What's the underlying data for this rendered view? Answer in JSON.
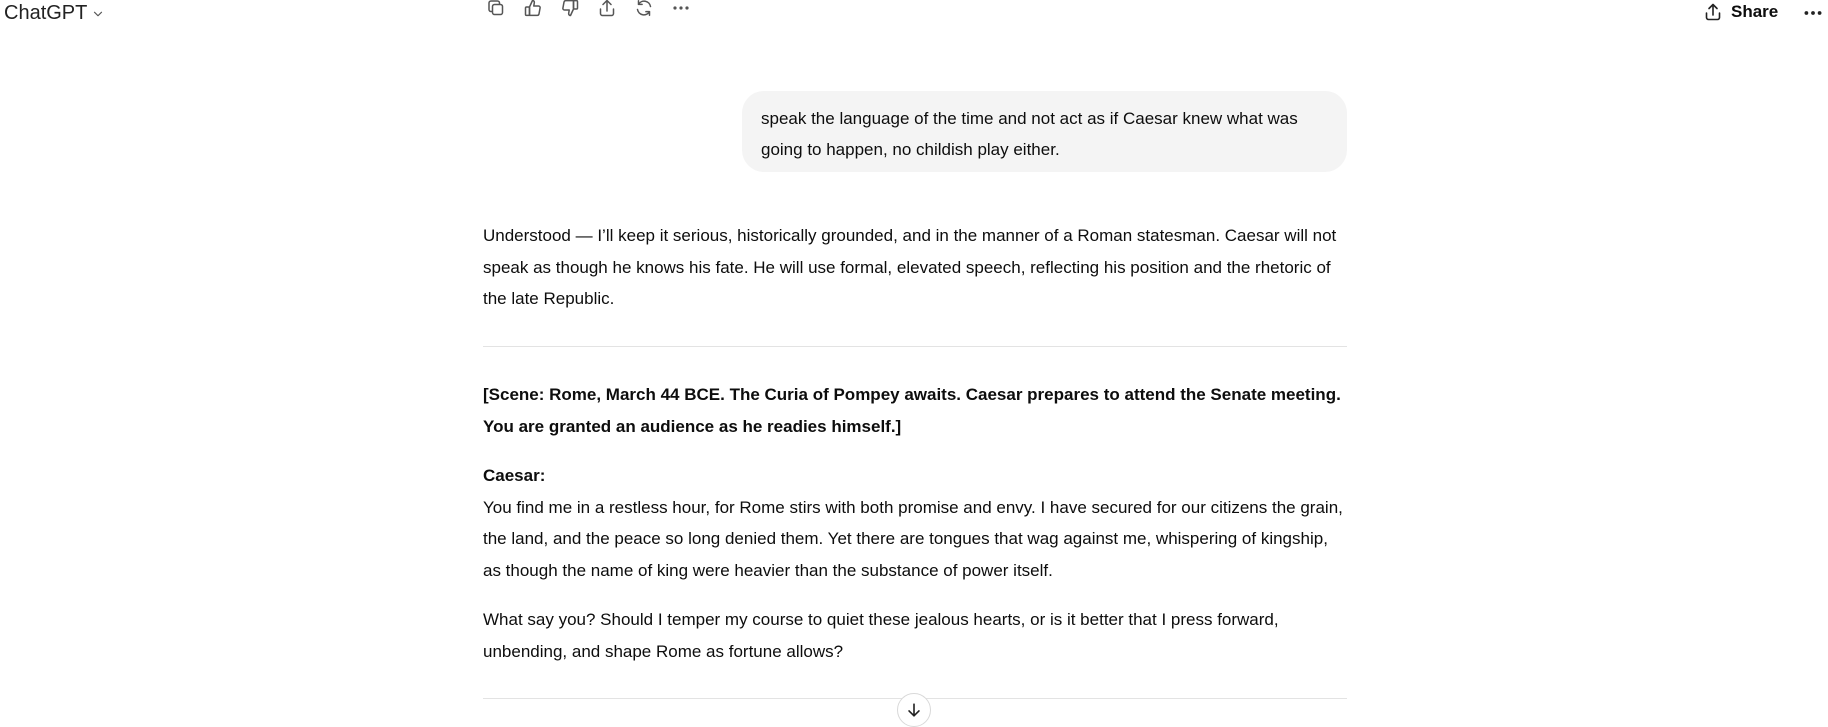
{
  "header": {
    "app_title": "ChatGPT",
    "share_label": "Share",
    "icons": [
      "copy-icon",
      "thumbs-up-icon",
      "thumbs-down-icon",
      "share-upload-icon",
      "regenerate-icon",
      "more-icon"
    ]
  },
  "conversation": {
    "user_message": " speak the language of the time and not act as if Caesar knew what was going to happen, no childish play either.",
    "assistant_intro": "Understood — I’ll keep it serious, historically grounded, and in the manner of a Roman statesman. Caesar will not speak as though he knows his fate. He will use formal, elevated speech, reflecting his position and the rhetoric of the late Republic.",
    "scene": "[Scene: Rome, March 44 BCE. The Curia of Pompey awaits. Caesar prepares to attend the Senate meeting. You are granted an audience as he readies himself.]",
    "speaker": "Caesar:",
    "speech_1": "You find me in a restless hour, for Rome stirs with both promise and envy. I have secured for our citizens the grain, the land, and the peace so long denied them. Yet there are tongues that wag against me, whispering of kingship, as though the name of king were heavier than the substance of power itself.",
    "speech_2": "What say you? Should I temper my course to quiet these jealous hearts, or is it better that I press forward, unbending, and shape Rome as fortune allows?"
  },
  "colors": {
    "bubble_bg": "#f4f4f4",
    "text": "#0d0d0d",
    "divider": "#e3e3e3"
  }
}
